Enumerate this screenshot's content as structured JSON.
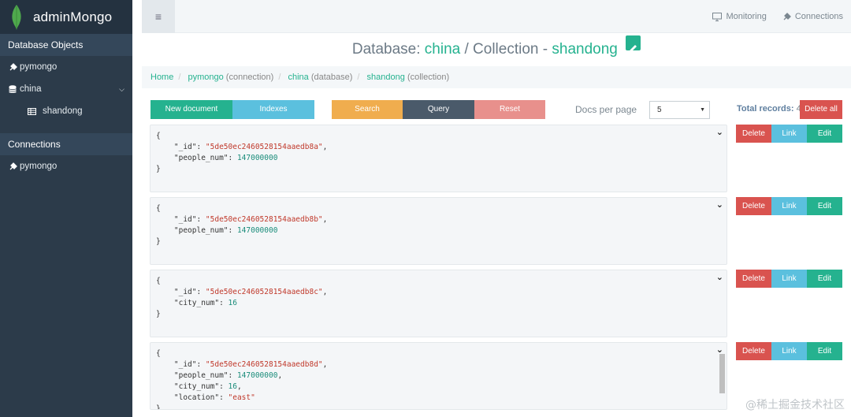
{
  "app": {
    "name": "adminMongo"
  },
  "sidebar": {
    "section_db": "Database Objects",
    "connection_item": "pymongo",
    "db_item": "china",
    "collection_item": "shandong",
    "section_conn": "Connections",
    "conn_item": "pymongo"
  },
  "topbar": {
    "monitoring": "Monitoring",
    "connections": "Connections"
  },
  "title": {
    "db_prefix": "Database:",
    "db": "china",
    "coll_prefix": "/ Collection -",
    "coll": "shandong"
  },
  "breadcrumb": {
    "home": "Home",
    "conn": "pymongo",
    "conn_type": "(connection)",
    "db": "china",
    "db_type": "(database)",
    "coll": "shandong",
    "coll_type": "(collection)"
  },
  "toolbar": {
    "new_document": "New document",
    "indexes": "Indexes",
    "search": "Search",
    "query": "Query",
    "reset": "Reset",
    "docs_per_page_label": "Docs per page",
    "docs_per_page_value": "5",
    "total_label": "Total records:",
    "total_value": "4",
    "delete_all": "Delete all"
  },
  "row_actions": {
    "delete": "Delete",
    "link": "Link",
    "edit": "Edit"
  },
  "documents": [
    {
      "lines": [
        [
          "{"
        ],
        [
          "    \"_id\": ",
          "\"5de50ec2460528154aaedb8a\"",
          ","
        ],
        [
          "    \"people_num\": ",
          "147000000",
          ""
        ],
        [
          "}"
        ]
      ]
    },
    {
      "lines": [
        [
          "{"
        ],
        [
          "    \"_id\": ",
          "\"5de50ec2460528154aaedb8b\"",
          ","
        ],
        [
          "    \"people_num\": ",
          "147000000",
          ""
        ],
        [
          "}"
        ]
      ]
    },
    {
      "lines": [
        [
          "{"
        ],
        [
          "    \"_id\": ",
          "\"5de50ec2460528154aaedb8c\"",
          ","
        ],
        [
          "    \"city_num\": ",
          "16",
          ""
        ],
        [
          "}"
        ]
      ]
    },
    {
      "lines": [
        [
          "{"
        ],
        [
          "    \"_id\": ",
          "\"5de50ec2460528154aaedb8d\"",
          ","
        ],
        [
          "    \"people_num\": ",
          "147000000",
          ","
        ],
        [
          "    \"city_num\": ",
          "16",
          ","
        ],
        [
          "    \"location\": ",
          "\"east\"",
          ""
        ],
        [
          "}"
        ]
      ]
    }
  ],
  "watermark": "@稀土掘金技术社区",
  "colors": {
    "accent": "#25b28f",
    "info": "#5bc0de",
    "warning": "#f0ad4e",
    "dark": "#4a5a6a",
    "danger_light": "#e8908c",
    "danger": "#d9534f"
  }
}
